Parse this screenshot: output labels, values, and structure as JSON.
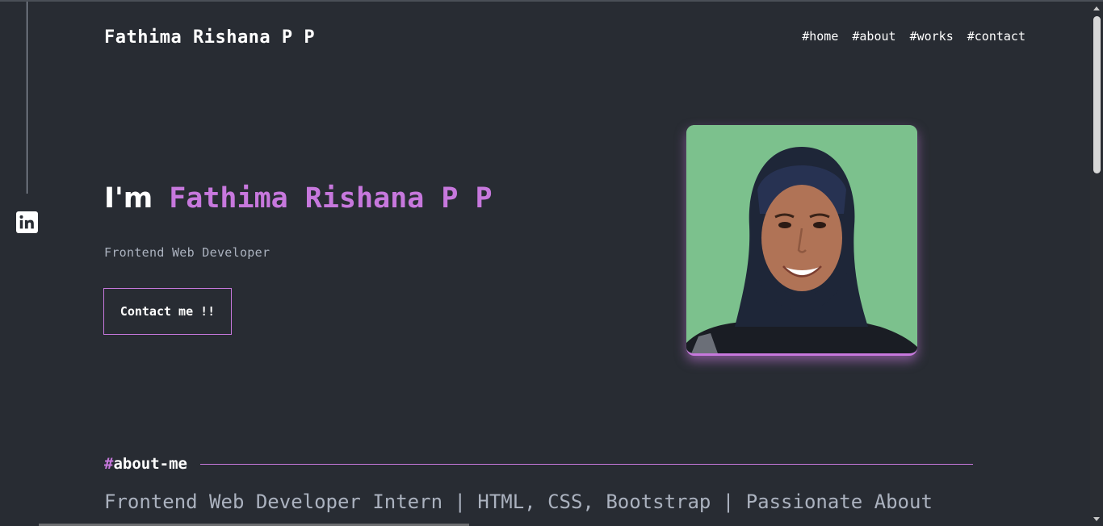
{
  "brand": "Fathima Rishana P P",
  "nav": [
    {
      "label": "#home"
    },
    {
      "label": "#about"
    },
    {
      "label": "#works"
    },
    {
      "label": "#contact"
    }
  ],
  "hero": {
    "greeting": "I'm",
    "name": "Fathima Rishana P P",
    "subtitle": "Frontend Web Developer",
    "cta": "Contact me !!"
  },
  "about": {
    "hash": "#",
    "title": "about-me",
    "text": "Frontend Web Developer Intern | HTML, CSS, Bootstrap | Passionate About"
  },
  "icons": {
    "social": "linkedin-icon"
  },
  "colors": {
    "background": "#282c33",
    "accent": "#c778dd",
    "muted": "#abb2bf"
  }
}
